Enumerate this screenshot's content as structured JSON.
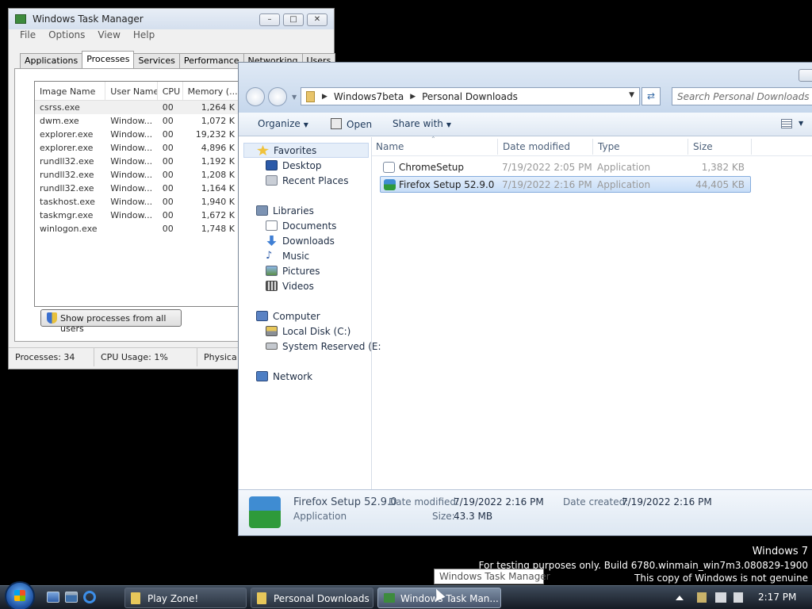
{
  "task_manager": {
    "title": "Windows Task Manager",
    "menu": [
      "File",
      "Options",
      "View",
      "Help"
    ],
    "tabs": [
      "Applications",
      "Processes",
      "Services",
      "Performance",
      "Networking",
      "Users"
    ],
    "active_tab": "Processes",
    "columns": [
      "Image Name",
      "User Name",
      "CPU",
      "Memory (..."
    ],
    "processes": [
      {
        "name": "csrss.exe",
        "user": "",
        "cpu": "00",
        "mem": "1,264 K"
      },
      {
        "name": "dwm.exe",
        "user": "Window...",
        "cpu": "00",
        "mem": "1,072 K"
      },
      {
        "name": "explorer.exe",
        "user": "Window...",
        "cpu": "00",
        "mem": "19,232 K"
      },
      {
        "name": "explorer.exe",
        "user": "Window...",
        "cpu": "00",
        "mem": "4,896 K"
      },
      {
        "name": "rundll32.exe",
        "user": "Window...",
        "cpu": "00",
        "mem": "1,192 K"
      },
      {
        "name": "rundll32.exe",
        "user": "Window...",
        "cpu": "00",
        "mem": "1,208 K"
      },
      {
        "name": "rundll32.exe",
        "user": "Window...",
        "cpu": "00",
        "mem": "1,164 K"
      },
      {
        "name": "taskhost.exe",
        "user": "Window...",
        "cpu": "00",
        "mem": "1,940 K"
      },
      {
        "name": "taskmgr.exe",
        "user": "Window...",
        "cpu": "00",
        "mem": "1,672 K"
      },
      {
        "name": "winlogon.exe",
        "user": "",
        "cpu": "00",
        "mem": "1,748 K"
      }
    ],
    "show_all_label": "Show processes from all users",
    "status": {
      "processes": "Processes: 34",
      "cpu": "CPU Usage: 1%",
      "physical": "Physica"
    }
  },
  "explorer": {
    "breadcrumb": [
      "Windows7beta",
      "Personal Downloads"
    ],
    "search_placeholder": "Search Personal Downloads",
    "toolbar": {
      "organize": "Organize",
      "open": "Open",
      "share": "Share with"
    },
    "nav": {
      "favorites": "Favorites",
      "desktop": "Desktop",
      "recent": "Recent Places",
      "libraries": "Libraries",
      "documents": "Documents",
      "downloads": "Downloads",
      "music": "Music",
      "pictures": "Pictures",
      "videos": "Videos",
      "computer": "Computer",
      "local_disk": "Local Disk (C:)",
      "system_reserved": "System Reserved (E:",
      "network": "Network"
    },
    "columns": {
      "name": "Name",
      "date": "Date modified",
      "type": "Type",
      "size": "Size"
    },
    "files": [
      {
        "name": "ChromeSetup",
        "date": "7/19/2022 2:05 PM",
        "type": "Application",
        "size": "1,382 KB"
      },
      {
        "name": "Firefox Setup 52.9.0",
        "date": "7/19/2022 2:16 PM",
        "type": "Application",
        "size": "44,405 KB"
      }
    ],
    "details": {
      "name": "Firefox Setup 52.9.0",
      "type": "Application",
      "date_modified_label": "Date modified:",
      "date_modified": "7/19/2022 2:16 PM",
      "date_created_label": "Date created:",
      "date_created": "7/19/2022 2:16 PM",
      "size_label": "Size:",
      "size": "43.3 MB"
    }
  },
  "watermark": {
    "line1": "Windows 7",
    "line2": "For testing purposes only. Build 6780.winmain_win7m3.080829-1900",
    "line3": "This copy of Windows is not genuine"
  },
  "tooltip": "Windows Task Manager",
  "taskbar": {
    "buttons": [
      "Play Zone!",
      "Personal Downloads",
      "Windows Task Man..."
    ],
    "clock": "2:17 PM"
  },
  "colors": {
    "selection_bg": "#cde0f7",
    "selection_border": "#84acdd",
    "taskbar": "#1f2732"
  }
}
